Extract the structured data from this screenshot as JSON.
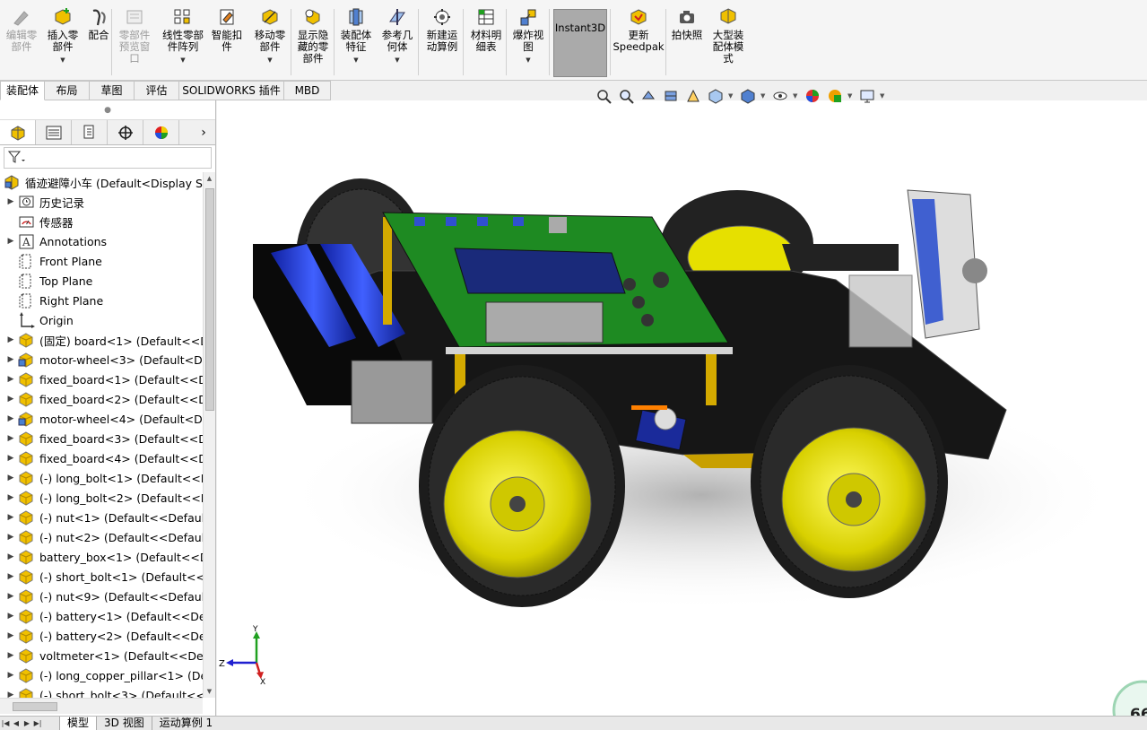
{
  "ribbon": {
    "buttons": [
      {
        "label": "编辑零\n部件",
        "icon": "edit-component-icon",
        "disabled": true,
        "dropdown": false
      },
      {
        "label": "插入零\n部件",
        "icon": "insert-component-icon",
        "disabled": false,
        "dropdown": true
      },
      {
        "label": "配合",
        "icon": "mate-icon",
        "disabled": false,
        "dropdown": false
      },
      {
        "label": "零部件\n预览窗\n口",
        "icon": "component-preview-icon",
        "disabled": true,
        "dropdown": false
      },
      {
        "label": "线性零部\n件阵列",
        "icon": "linear-pattern-icon",
        "disabled": false,
        "dropdown": true
      },
      {
        "label": "智能扣\n件",
        "icon": "smart-fasteners-icon",
        "disabled": false,
        "dropdown": false
      },
      {
        "label": "移动零\n部件",
        "icon": "move-component-icon",
        "disabled": false,
        "dropdown": true
      },
      {
        "label": "显示隐\n藏的零\n部件",
        "icon": "show-hidden-icon",
        "disabled": false,
        "dropdown": false
      },
      {
        "label": "装配体\n特征",
        "icon": "assembly-features-icon",
        "disabled": false,
        "dropdown": true
      },
      {
        "label": "参考几\n何体",
        "icon": "reference-geometry-icon",
        "disabled": false,
        "dropdown": true
      },
      {
        "label": "新建运\n动算例",
        "icon": "new-motion-study-icon",
        "disabled": false,
        "dropdown": false
      },
      {
        "label": "材料明\n细表",
        "icon": "bill-of-materials-icon",
        "disabled": false,
        "dropdown": false
      },
      {
        "label": "爆炸视\n图",
        "icon": "exploded-view-icon",
        "disabled": false,
        "dropdown": true
      },
      {
        "label": "Instant3D",
        "icon": "instant3d-icon",
        "disabled": false,
        "dropdown": false,
        "active": true
      },
      {
        "label": "更新\nSpeedpak",
        "icon": "speedpak-icon",
        "disabled": false,
        "dropdown": false
      },
      {
        "label": "拍快照",
        "icon": "snapshot-icon",
        "disabled": false,
        "dropdown": false
      },
      {
        "label": "大型装\n配体模\n式",
        "icon": "large-assembly-icon",
        "disabled": false,
        "dropdown": false
      }
    ]
  },
  "tabs": [
    "装配体",
    "布局",
    "草图",
    "评估",
    "SOLIDWORKS 插件",
    "MBD"
  ],
  "tree": {
    "root": "循迹避障小车  (Default<Display Sta",
    "items": [
      {
        "label": "历史记录",
        "icon": "history-folder-icon",
        "expand": true
      },
      {
        "label": "传感器",
        "icon": "sensor-icon",
        "expand": false
      },
      {
        "label": "Annotations",
        "icon": "annotations-icon",
        "expand": true
      },
      {
        "label": "Front Plane",
        "icon": "plane-icon",
        "expand": false
      },
      {
        "label": "Top Plane",
        "icon": "plane-icon",
        "expand": false
      },
      {
        "label": "Right Plane",
        "icon": "plane-icon",
        "expand": false
      },
      {
        "label": "Origin",
        "icon": "origin-icon",
        "expand": false
      },
      {
        "label": "(固定) board<1> (Default<<D",
        "icon": "part-icon",
        "expand": true
      },
      {
        "label": "motor-wheel<3> (Default<Dis",
        "icon": "subassembly-icon",
        "expand": true
      },
      {
        "label": "fixed_board<1> (Default<<De",
        "icon": "part-icon",
        "expand": true
      },
      {
        "label": "fixed_board<2> (Default<<De",
        "icon": "part-icon",
        "expand": true
      },
      {
        "label": "motor-wheel<4> (Default<Dis",
        "icon": "subassembly-icon",
        "expand": true
      },
      {
        "label": "fixed_board<3> (Default<<De",
        "icon": "part-icon",
        "expand": true
      },
      {
        "label": "fixed_board<4> (Default<<De",
        "icon": "part-icon",
        "expand": true
      },
      {
        "label": "(-) long_bolt<1> (Default<<De",
        "icon": "part-icon",
        "expand": true
      },
      {
        "label": "(-) long_bolt<2> (Default<<De",
        "icon": "part-icon",
        "expand": true
      },
      {
        "label": "(-) nut<1> (Default<<Default>",
        "icon": "part-icon",
        "expand": true
      },
      {
        "label": "(-) nut<2> (Default<<Default>",
        "icon": "part-icon",
        "expand": true
      },
      {
        "label": "battery_box<1> (Default<<De",
        "icon": "part-icon",
        "expand": true
      },
      {
        "label": "(-) short_bolt<1> (Default<<D",
        "icon": "part-icon",
        "expand": true
      },
      {
        "label": "(-) nut<9> (Default<<Default>",
        "icon": "part-icon",
        "expand": true
      },
      {
        "label": "(-) battery<1> (Default<<Defa",
        "icon": "part-icon",
        "expand": true
      },
      {
        "label": "(-) battery<2> (Default<<Defa",
        "icon": "part-icon",
        "expand": true
      },
      {
        "label": "voltmeter<1> (Default<<Defa",
        "icon": "part-icon",
        "expand": true
      },
      {
        "label": "(-) long_copper_pillar<1> (De",
        "icon": "part-icon",
        "expand": true
      },
      {
        "label": "(-) short_bolt<3> (Default<<D",
        "icon": "part-icon",
        "expand": true
      }
    ]
  },
  "bottom_tabs": [
    "模型",
    "3D 视图",
    "运动算例 1"
  ],
  "triad": {
    "z": "Z",
    "x": "X",
    "y": "Y"
  },
  "badge": "66",
  "colors": {
    "accent": "#0070c0",
    "wheel": "#e6e000",
    "board": "#2a8a2a",
    "chassis": "#1a1a1a"
  }
}
